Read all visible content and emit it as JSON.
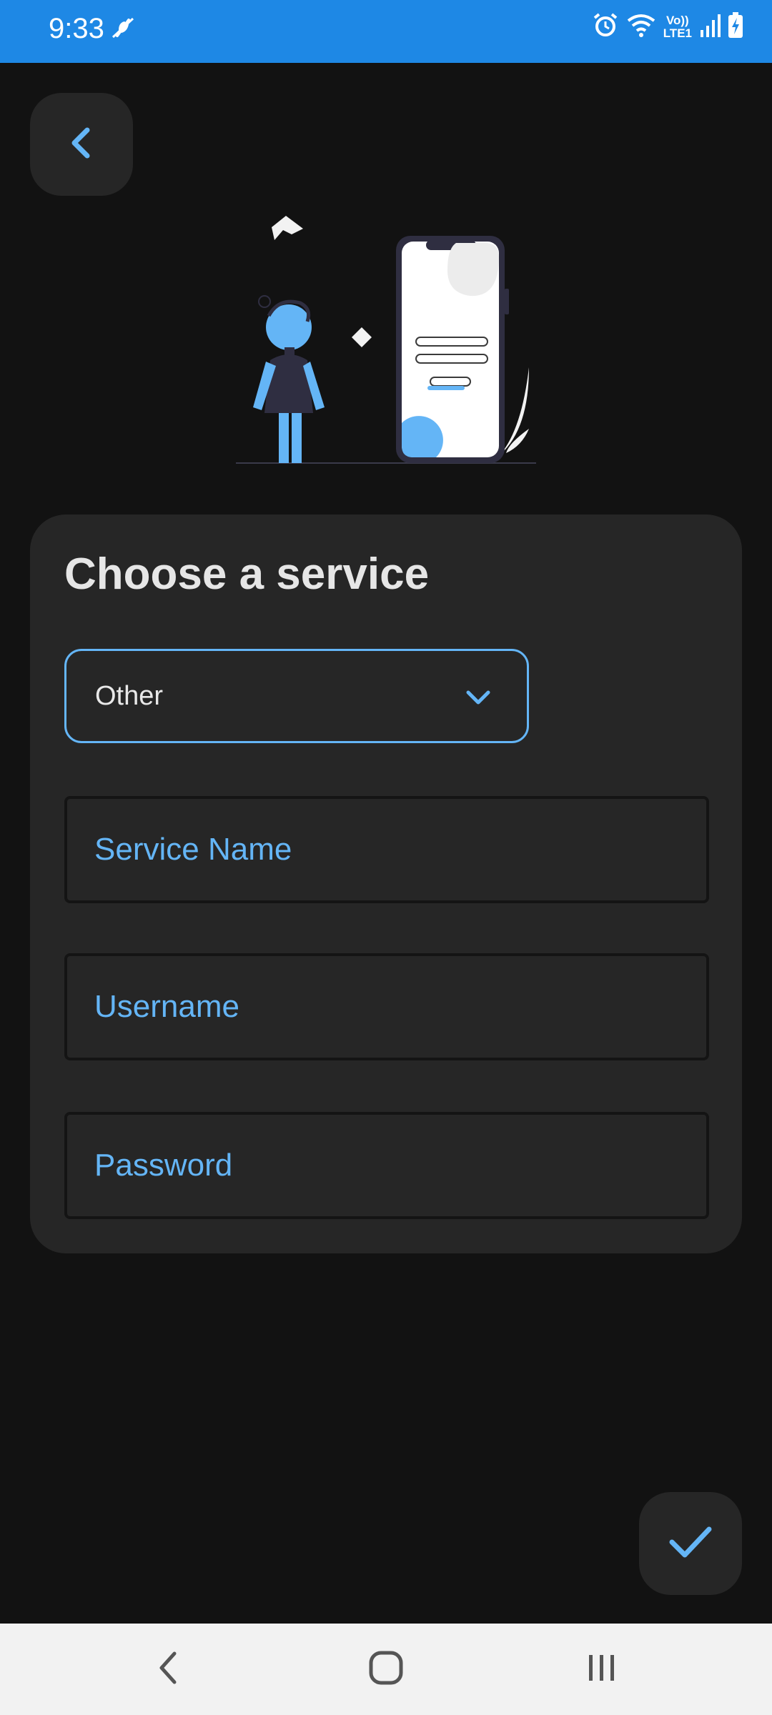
{
  "status_bar": {
    "time": "9:33",
    "lte_top": "Vo))",
    "lte_bottom": "LTE1",
    "icons": [
      "mute-mic-icon",
      "alarm-icon",
      "wifi-icon",
      "signal-icon",
      "battery-charging-icon"
    ]
  },
  "header": {
    "back_icon": "chevron-left-icon"
  },
  "card": {
    "title": "Choose a service",
    "service_select": {
      "value": "Other",
      "icon": "chevron-down-icon"
    },
    "fields": {
      "service_name": "Service Name",
      "username": "Username",
      "password": "Password"
    }
  },
  "fab": {
    "icon": "check-icon"
  },
  "nav_bar": {
    "icons": [
      "nav-back-icon",
      "nav-home-icon",
      "nav-recents-icon"
    ]
  },
  "colors": {
    "accent": "#64b5f6",
    "status_bar": "#1e88e5",
    "background": "#121212",
    "surface": "#262626"
  }
}
